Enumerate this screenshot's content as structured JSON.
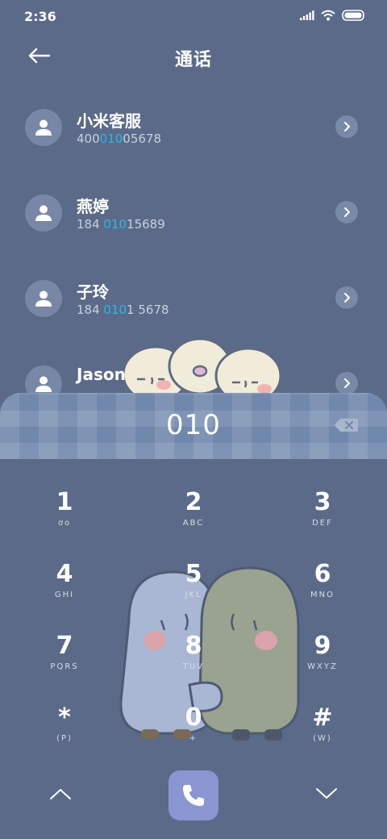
{
  "status_bar": {
    "time": "2:36"
  },
  "header": {
    "title": "通话"
  },
  "contacts": [
    {
      "name": "小米客服",
      "number_pre": "400",
      "number_match": "010",
      "number_post": "05678"
    },
    {
      "name": "燕婷",
      "number_pre": "184 ",
      "number_match": "010",
      "number_post": "15689"
    },
    {
      "name": "子玲",
      "number_pre": "184 ",
      "number_match": "010",
      "number_post": "1 5678"
    },
    {
      "name": "Jason",
      "number_pre": "",
      "number_match": "",
      "number_post": ""
    }
  ],
  "dialer": {
    "entered": "010"
  },
  "keypad": [
    {
      "digit": "1",
      "letters": "ơo"
    },
    {
      "digit": "2",
      "letters": "ABC"
    },
    {
      "digit": "3",
      "letters": "DEF"
    },
    {
      "digit": "4",
      "letters": "GHI"
    },
    {
      "digit": "5",
      "letters": "JKL"
    },
    {
      "digit": "6",
      "letters": "MNO"
    },
    {
      "digit": "7",
      "letters": "PQRS"
    },
    {
      "digit": "8",
      "letters": "TUV"
    },
    {
      "digit": "9",
      "letters": "WXYZ"
    },
    {
      "digit": "*",
      "letters": "(P)"
    },
    {
      "digit": "0",
      "letters": "+"
    },
    {
      "digit": "#",
      "letters": "(W)"
    }
  ],
  "colors": {
    "background": "#5b6a89",
    "highlight": "#2bb7e8",
    "call_button": "#8a96d2"
  }
}
